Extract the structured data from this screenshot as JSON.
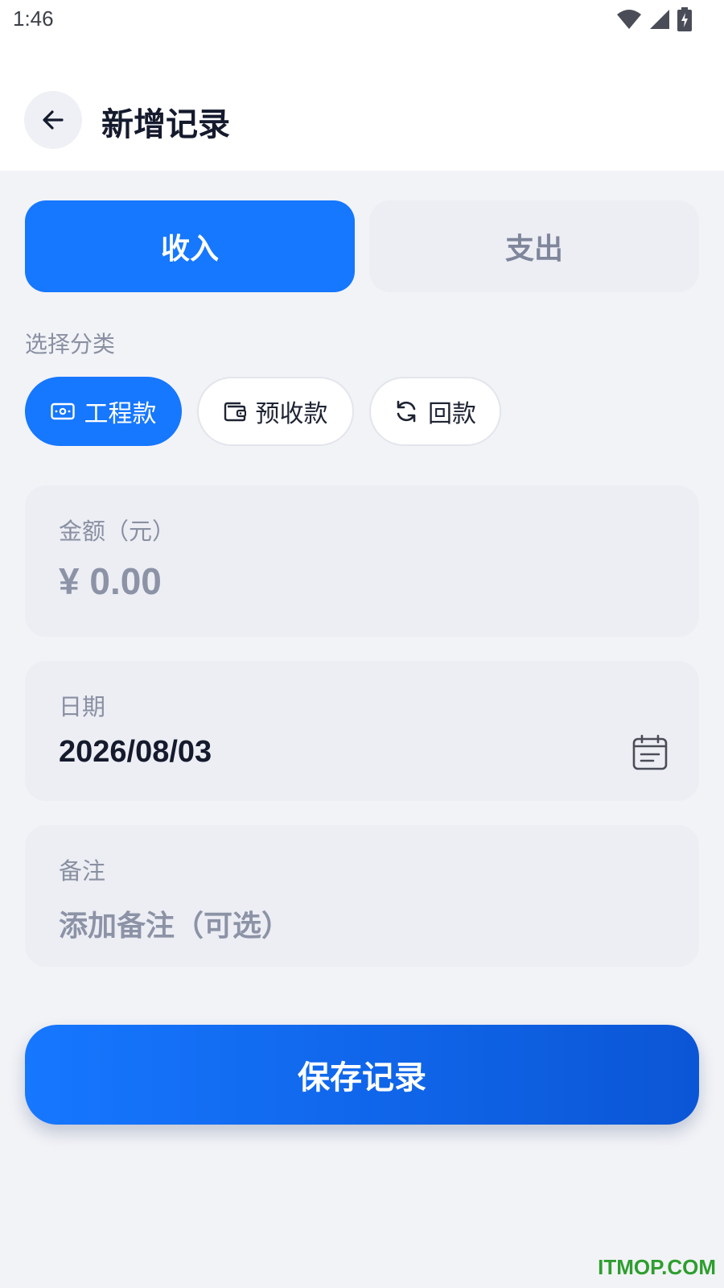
{
  "status_bar": {
    "time": "1:46",
    "icons": [
      "wifi-icon",
      "signal-icon",
      "battery-charging-icon"
    ]
  },
  "header": {
    "back_icon": "arrow-left-icon",
    "title": "新增记录"
  },
  "type_toggle": {
    "income_label": "收入",
    "expense_label": "支出",
    "selected": "收入"
  },
  "category": {
    "label": "选择分类",
    "chips": [
      {
        "label": "工程款",
        "icon": "banknote-icon",
        "selected": true
      },
      {
        "label": "预收款",
        "icon": "wallet-icon",
        "selected": false
      },
      {
        "label": "回款",
        "icon": "refresh-icon",
        "selected": false
      }
    ]
  },
  "amount": {
    "label": "金额（元）",
    "value": "¥ 0.00"
  },
  "date": {
    "label": "日期",
    "value": "2026/08/03",
    "icon": "calendar-icon"
  },
  "note": {
    "label": "备注",
    "placeholder": "添加备注（可选）"
  },
  "save_button": {
    "label": "保存记录"
  },
  "watermark": "ITMOP.COM",
  "colors": {
    "primary": "#1677ff",
    "primary_dark": "#0b56d6",
    "background": "#f2f3f7",
    "card": "#eceef4",
    "muted_text": "#8a90a2"
  }
}
